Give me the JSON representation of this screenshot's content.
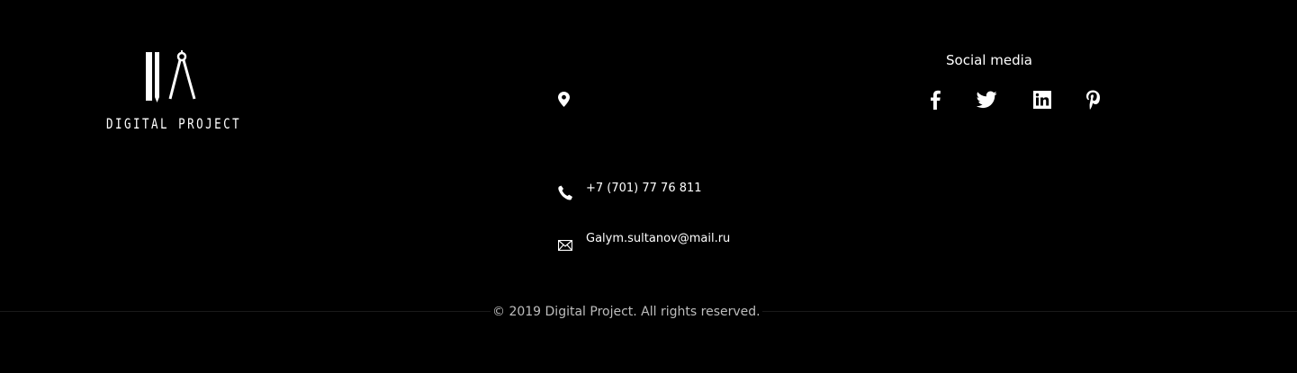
{
  "brand": {
    "logo_icon": "ruler-compass-logo-icon",
    "name": "DIGITAL PROJECT"
  },
  "contact": {
    "address_icon": "map-pin-icon",
    "address": "",
    "phone_icon": "phone-icon",
    "phone": "+7 (701) 77 76 811",
    "email_icon": "envelope-icon",
    "email": "Galym.sultanov@mail.ru"
  },
  "social": {
    "title": "Social media",
    "icons": [
      "facebook-icon",
      "twitter-icon",
      "linkedin-icon",
      "pinterest-icon"
    ]
  },
  "footer": {
    "copyright": "© 2019 Digital Project. All rights reserved."
  },
  "colors": {
    "background": "#000000",
    "text": "#ffffff",
    "muted_text": "#bdbdbd"
  }
}
